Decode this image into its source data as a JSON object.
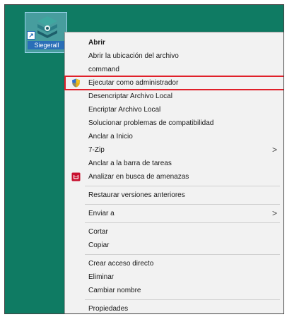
{
  "desktop": {
    "icon_label": "Siegerall",
    "shortcut_glyph": "↗"
  },
  "menu": {
    "items": [
      {
        "id": "abrir",
        "label": "Abrir",
        "bold": true
      },
      {
        "id": "abrir-ubicacion",
        "label": "Abrir la ubicación del archivo"
      },
      {
        "id": "command",
        "label": "command"
      },
      {
        "id": "ejecutar-admin",
        "label": "Ejecutar como administrador",
        "icon": "uac-shield-icon",
        "highlighted": true
      },
      {
        "id": "desencriptar",
        "label": "Desencriptar Archivo Local"
      },
      {
        "id": "encriptar",
        "label": "Encriptar Archivo Local"
      },
      {
        "id": "solucionar",
        "label": "Solucionar problemas de compatibilidad"
      },
      {
        "id": "anclar-inicio",
        "label": "Anclar a Inicio"
      },
      {
        "id": "7zip",
        "label": "7-Zip",
        "submenu": true
      },
      {
        "id": "anclar-barra",
        "label": "Anclar a la barra de tareas"
      },
      {
        "id": "analizar",
        "label": "Analizar en busca de amenazas",
        "icon": "mcafee-icon"
      },
      {
        "sep": true
      },
      {
        "id": "restaurar",
        "label": "Restaurar versiones anteriores"
      },
      {
        "sep": true
      },
      {
        "id": "enviar",
        "label": "Enviar a",
        "submenu": true
      },
      {
        "sep": true
      },
      {
        "id": "cortar",
        "label": "Cortar"
      },
      {
        "id": "copiar",
        "label": "Copiar"
      },
      {
        "sep": true
      },
      {
        "id": "crear-acceso",
        "label": "Crear acceso directo"
      },
      {
        "id": "eliminar",
        "label": "Eliminar"
      },
      {
        "id": "cambiar-nombre",
        "label": "Cambiar nombre"
      },
      {
        "sep": true
      },
      {
        "id": "propiedades",
        "label": "Propiedades"
      }
    ],
    "submenu_arrow": ">"
  },
  "colors": {
    "desktop_bg": "#0f7b63",
    "highlight_border": "#e0202a",
    "menu_bg": "#f2f2f2"
  }
}
